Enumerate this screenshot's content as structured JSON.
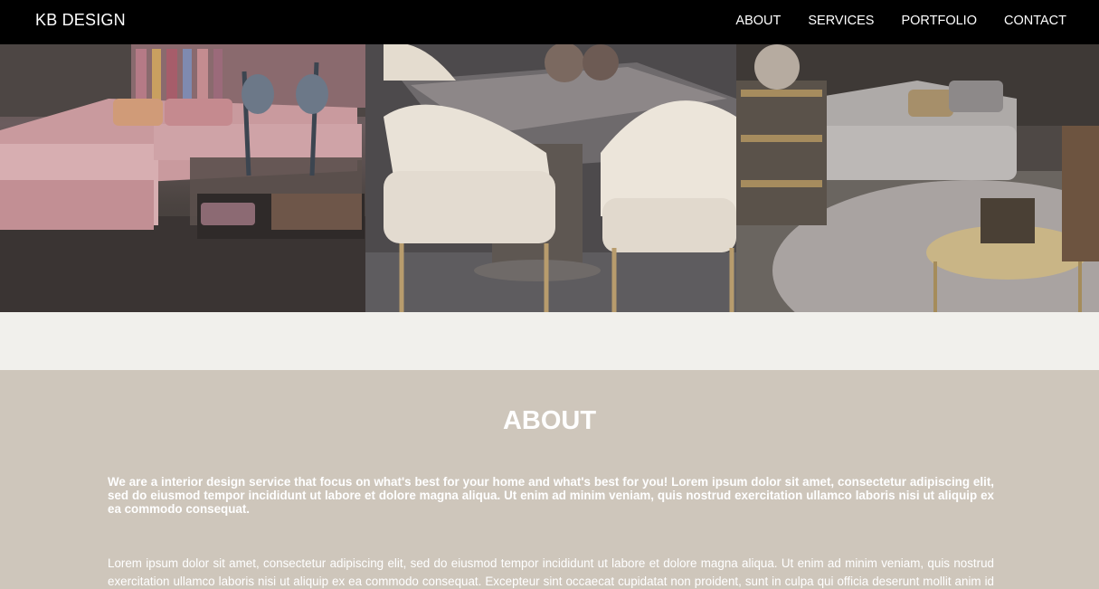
{
  "nav": {
    "brand": "KB DESIGN",
    "links": [
      "ABOUT",
      "SERVICES",
      "PORTFOLIO",
      "CONTACT"
    ]
  },
  "about": {
    "title": "ABOUT",
    "paragraph1": "We are a interior design service that focus on what's best for your home and what's best for you! Lorem ipsum dolor sit amet, consectetur adipiscing elit, sed do eiusmod tempor incididunt ut labore et dolore magna aliqua. Ut enim ad minim veniam, quis nostrud exercitation ullamco laboris nisi ut aliquip ex ea commodo consequat.",
    "paragraph2": "Lorem ipsum dolor sit amet, consectetur adipiscing elit, sed do eiusmod tempor incididunt ut labore et dolore magna aliqua. Ut enim ad minim veniam, quis nostrud exercitation ullamco laboris nisi ut aliquip ex ea commodo consequat. Excepteur sint occaecat cupidatat non proident, sunt in culpa qui officia deserunt mollit anim id est laborum."
  },
  "colors": {
    "navbar": "#000000",
    "about_background": "#cec6bb",
    "page_background": "#f1f0ec"
  }
}
